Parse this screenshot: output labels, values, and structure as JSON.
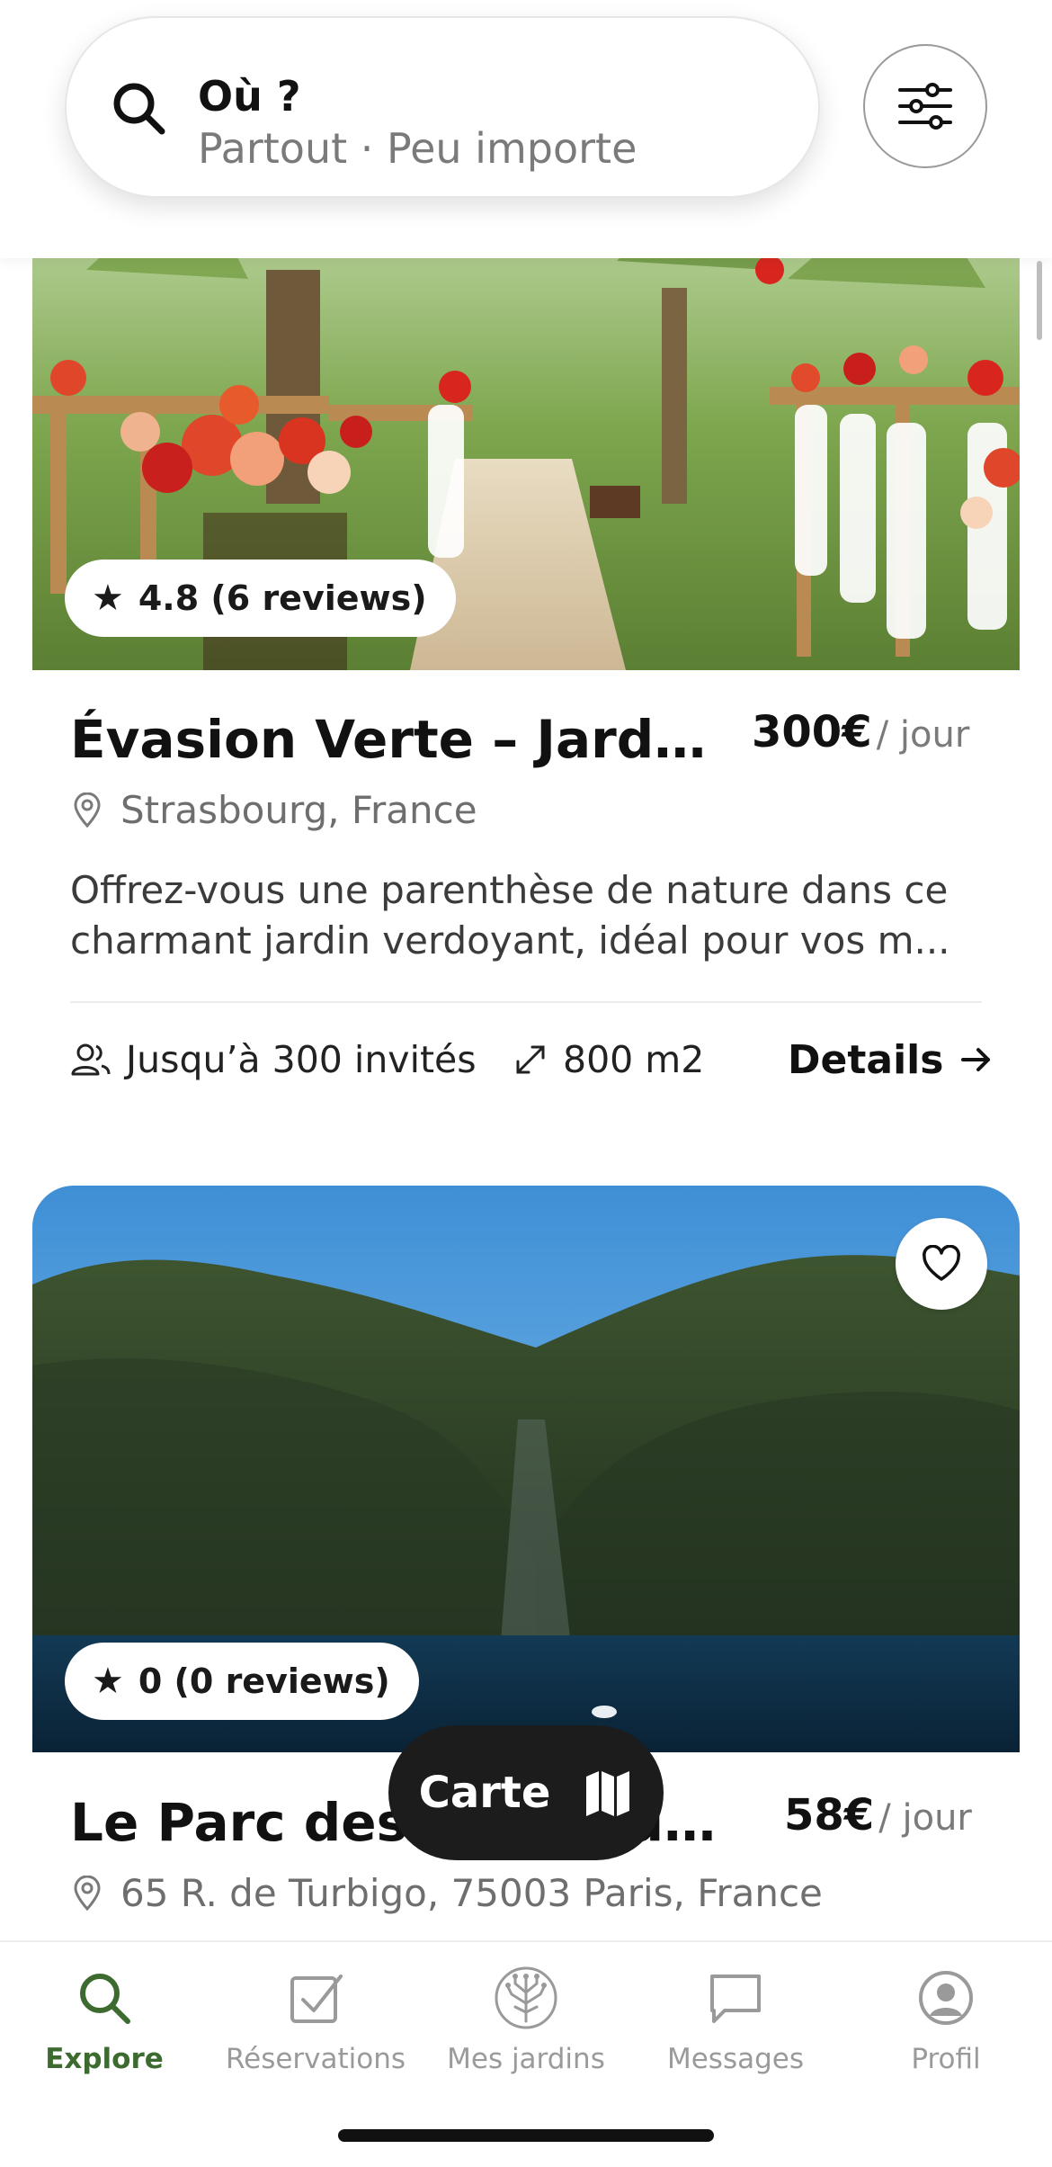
{
  "search": {
    "title": "Où ?",
    "subtitle": "Partout · Peu importe"
  },
  "listings": [
    {
      "rating": "4.8 (6 reviews)",
      "title": "Évasion Verte – Jardi...",
      "price": "300€",
      "price_unit": "/ jour",
      "location": "Strasbourg, France",
      "description_line1": "Offrez-vous une parenthèse de nature dans ce",
      "description_line2": "charmant jardin verdoyant, idéal pour vos m...",
      "guests": "Jusqu’à 300 invités",
      "area": "800 m2",
      "details_label": "Details"
    },
    {
      "rating": "0 (0 reviews)",
      "title": "Le Parc des Calanques...",
      "price": "58€",
      "price_unit": "/ jour",
      "location": "65 R. de Turbigo, 75003 Paris, France"
    }
  ],
  "map_button": {
    "label": "Carte"
  },
  "nav": {
    "items": [
      {
        "label": "Explore",
        "icon": "search-icon"
      },
      {
        "label": "Réservations",
        "icon": "checkbox-icon"
      },
      {
        "label": "Mes jardins",
        "icon": "tree-icon"
      },
      {
        "label": "Messages",
        "icon": "chat-icon"
      },
      {
        "label": "Profil",
        "icon": "user-icon"
      }
    ]
  },
  "colors": {
    "accent": "#3d6b2f",
    "inactive": "#9a9a9a",
    "dark_button": "#1c1c1c"
  }
}
